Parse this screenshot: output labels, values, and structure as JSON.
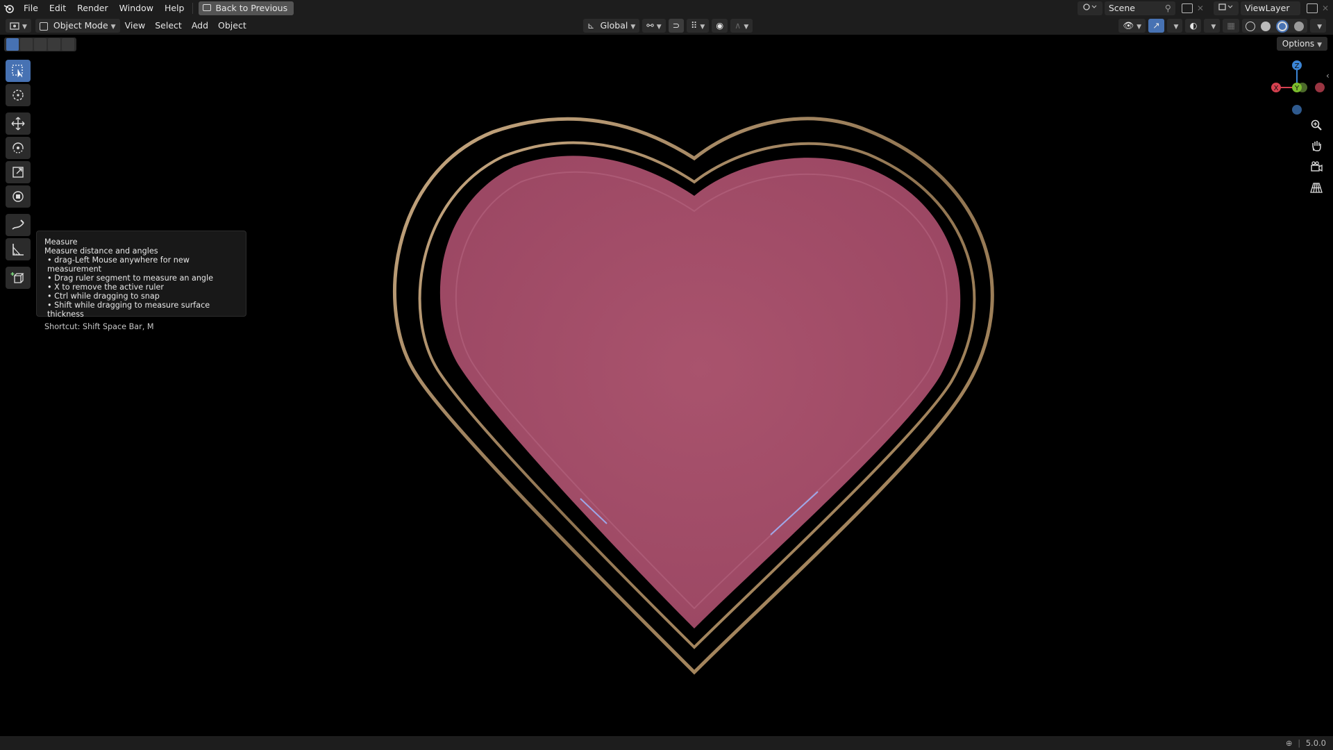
{
  "menu": {
    "file": "File",
    "edit": "Edit",
    "render": "Render",
    "window": "Window",
    "help": "Help",
    "back_to_previous": "Back to Previous"
  },
  "top_right": {
    "scene": "Scene",
    "view_layer": "ViewLayer"
  },
  "header": {
    "mode": "Object Mode",
    "view": "View",
    "select": "Select",
    "add": "Add",
    "object": "Object",
    "orientation": "Global",
    "options": "Options"
  },
  "tooltip": {
    "title": "Measure",
    "description": "Measure distance and angles",
    "items": [
      "drag-Left Mouse anywhere for new measurement",
      "Drag ruler segment to measure an angle",
      "X to remove the active ruler",
      "Ctrl while dragging to snap",
      "Shift while dragging to measure surface thickness"
    ],
    "shortcut": "Shortcut: Shift Space Bar, M"
  },
  "gizmo": {
    "z": "Z",
    "x": "X",
    "y": "Y"
  },
  "status": {
    "version": "5.0.0"
  },
  "colors": {
    "heart_fill": "#a5506a",
    "ring": "#a88b63",
    "active_tool": "#4772b3",
    "axis_x": "#d5404f",
    "axis_y": "#7bbd2d",
    "axis_z": "#3b85d6"
  }
}
